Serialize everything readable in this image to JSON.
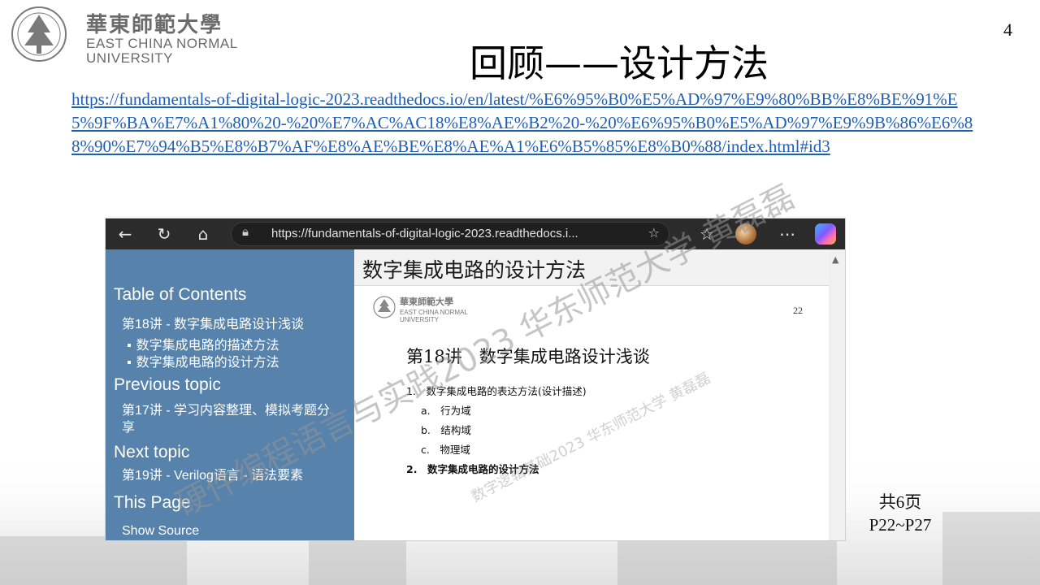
{
  "logo": {
    "chinese_name": "華東師範大學",
    "english_line1": "EAST CHINA NORMAL",
    "english_line2": "UNIVERSITY"
  },
  "page_number": "4",
  "title": "回顾——设计方法",
  "link_url": "https://fundamentals-of-digital-logic-2023.readthedocs.io/en/latest/%E6%95%B0%E5%AD%97%E9%80%BB%E8%BE%91%E5%9F%BA%E7%A1%80%20-%20%E7%AC%AC18%E8%AE%B2%20-%20%E6%95%B0%E5%AD%97%E9%9B%86%E6%88%90%E7%94%B5%E8%B7%AF%E8%AE%BE%E8%AE%A1%E6%B5%85%E8%B0%88/index.html#id3",
  "browser": {
    "address_url": "https://fundamentals-of-digital-logic-2023.readthedocs.i...",
    "icons": [
      "back-icon",
      "refresh-icon",
      "home-icon",
      "lock-icon",
      "reader-icon",
      "favorites-icon",
      "more-icon",
      "copilot-icon"
    ],
    "sidebar": {
      "toc_heading": "Table of Contents",
      "toc_item": "第18讲 - 数字集成电路设计浅谈",
      "toc_sub1": "数字集成电路的描述方法",
      "toc_sub2": "数字集成电路的设计方法",
      "prev_heading": "Previous topic",
      "prev_item": "第17讲 - 学习内容整理、模拟考题分享",
      "next_heading": "Next topic",
      "next_item": "第19讲 - Verilog语言 - 语法要素",
      "this_page_heading": "This Page",
      "show_source": "Show Source"
    },
    "content": {
      "heading": "数字集成电路的设计方法",
      "thumb_logo_cn": "華東師範大學",
      "thumb_logo_en1": "EAST CHINA NORMAL",
      "thumb_logo_en2": "UNIVERSITY",
      "thumb_page": "22",
      "thumb_title": "第18讲　数字集成电路设计浅谈",
      "list": {
        "item1": "1.　数字集成电路的表达方法(设计描述)",
        "sub_a": "a.　行为域",
        "sub_b": "b.　结构域",
        "sub_c": "c.　物理域",
        "item2": "2.　数字集成电路的设计方法"
      }
    }
  },
  "watermarks": {
    "large": "硬件编程语言与实践2023 华东师范大学 黄磊磊",
    "small": "数字逻辑基础2023 华东师范大学 黄磊磊"
  },
  "page_count": {
    "line1": "共6页",
    "line2": "P22~P27"
  }
}
